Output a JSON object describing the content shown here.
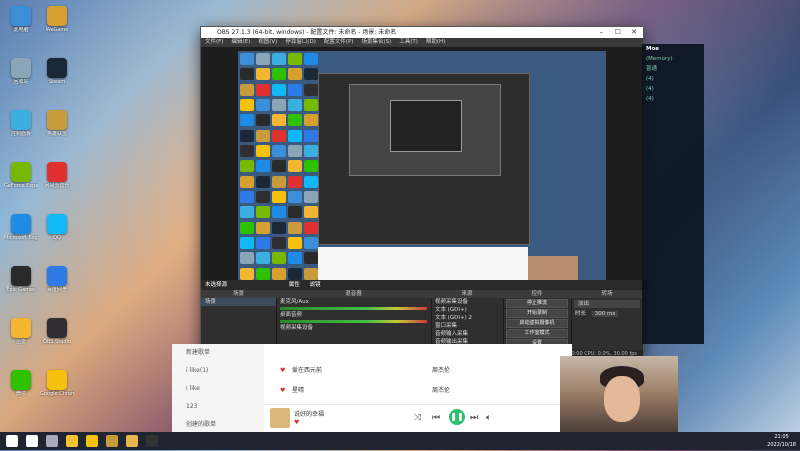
{
  "obs": {
    "title": "OBS 27.1.3 (64-bit, windows) - 配置文件: 未命名 - 场景: 未命名",
    "menu": [
      "文件(F)",
      "编辑(E)",
      "视图(V)",
      "停靠窗口(D)",
      "配置文件(P)",
      "场景集合(S)",
      "工具(T)",
      "帮助(H)"
    ],
    "filter_label": "未选择源",
    "props_button": "属性",
    "filters_button": "滤镜",
    "scenes": {
      "header": "场景",
      "items": [
        "场景"
      ]
    },
    "sources": {
      "header": "来源",
      "items": [
        "视频采集设备",
        "文本 (GDI+)",
        "文本 (GDI+) 2",
        "窗口采集",
        "音频输入采集",
        "音频输出采集",
        "显示器采集"
      ]
    },
    "mixer": {
      "header": "混音器",
      "tracks": [
        "麦克风/Aux",
        "桌面音频",
        "视频采集设备"
      ]
    },
    "transitions": {
      "header": "转场",
      "value": "淡出",
      "duration_label": "时长",
      "duration_value": "300 ms"
    },
    "controls": {
      "header": "控件",
      "buttons": [
        "停止推流",
        "开始录制",
        "启动虚拟摄像机",
        "工作室模式",
        "设置",
        "退出"
      ]
    },
    "status": "LIVE: 00:00:00    REC: 00:00:00    CPU: 0.0%, 30.00 fps"
  },
  "desktop": {
    "icons": [
      {
        "label": "此电脑",
        "color": "#3b8fd8"
      },
      {
        "label": "回收站",
        "color": "#8aa4b8"
      },
      {
        "label": "控制面板",
        "color": "#3bb0e0"
      },
      {
        "label": "GeForce Experience",
        "color": "#76b900"
      },
      {
        "label": "Microsoft Edge",
        "color": "#1e8be6"
      },
      {
        "label": "Epic Games",
        "color": "#2a2a2a"
      },
      {
        "label": "迅雷",
        "color": "#f2b630"
      },
      {
        "label": "微信",
        "color": "#2dc100"
      },
      {
        "label": "WeGame",
        "color": "#d8a030"
      },
      {
        "label": "Steam",
        "color": "#1b2838"
      },
      {
        "label": "英雄联盟",
        "color": "#c89b3c"
      },
      {
        "label": "网易云音乐",
        "color": "#e03030"
      },
      {
        "label": "QQ",
        "color": "#12b7f5"
      },
      {
        "label": "百度网盘",
        "color": "#2e7be8"
      },
      {
        "label": "OBS Studio",
        "color": "#302e31"
      },
      {
        "label": "Google Chrome",
        "color": "#f4c20d"
      }
    ]
  },
  "client": {
    "name": "Moe",
    "lines": [
      "(Memory)",
      "普通",
      "(4)",
      "(4)",
      "(4)"
    ]
  },
  "music": {
    "nav": [
      "新建歌单",
      "i like(1)",
      "i like",
      "123",
      "创建的歌单"
    ],
    "songs": [
      {
        "title": "爱在西元前",
        "artist": "周杰伦"
      },
      {
        "title": "星晴",
        "artist": "周杰伦"
      }
    ],
    "now_playing": {
      "title": "说好的幸福",
      "artist": "周杰伦"
    }
  },
  "taskbar": {
    "time": "21:05",
    "date": "2022/10/18",
    "items": [
      "start-icon",
      "search-icon",
      "taskview-icon",
      "explorer-icon",
      "chrome-icon",
      "lol-icon",
      "folder-icon",
      "obs-icon"
    ]
  }
}
